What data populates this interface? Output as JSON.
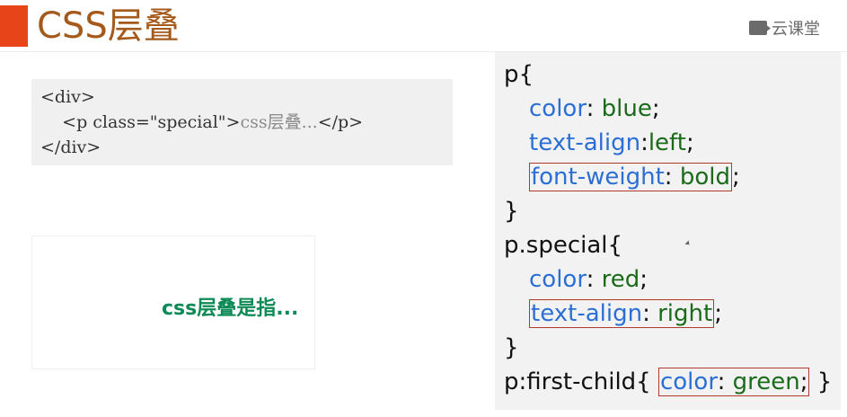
{
  "colors": {
    "accent": "#e8441a",
    "title": "#a55a1c",
    "css_property": "#2b6fd4",
    "css_value": "#1b6b1b",
    "preview_text": "#0d8a55",
    "highlight_border": "#b03a2e"
  },
  "header": {
    "title": "CSS层叠",
    "logo_icon": "chat-bubble-icon",
    "logo_text": "云课堂"
  },
  "html_code": {
    "line1": "<div>",
    "line2_tag": "    <p class=\"special\">",
    "line2_text": "css层叠...",
    "line2_close": "</p>",
    "line3": "</div>"
  },
  "preview": {
    "text": "css层叠是指..."
  },
  "css_code": {
    "l1": "p{",
    "l2_prop": "color",
    "l2_sep": ": ",
    "l2_val": "blue",
    "l2_end": ";",
    "l3_prop": "text-align",
    "l3_sep": ":",
    "l3_val": "left",
    "l3_end": ";",
    "l4_prop": "font-weight",
    "l4_sep": ": ",
    "l4_val": "bold",
    "l4_end": ";",
    "l5": "}",
    "l6": "p.special{",
    "l7_prop": "color",
    "l7_sep": ": ",
    "l7_val": "red",
    "l7_end": ";",
    "l8_prop": "text-align",
    "l8_sep": ": ",
    "l8_val": "right",
    "l8_end": ";",
    "l9": "}",
    "l10_sel": "p:first-child{ ",
    "l10_prop": "color",
    "l10_sep": ": ",
    "l10_val": "green",
    "l10_semi": ";",
    "l10_end": " }"
  }
}
